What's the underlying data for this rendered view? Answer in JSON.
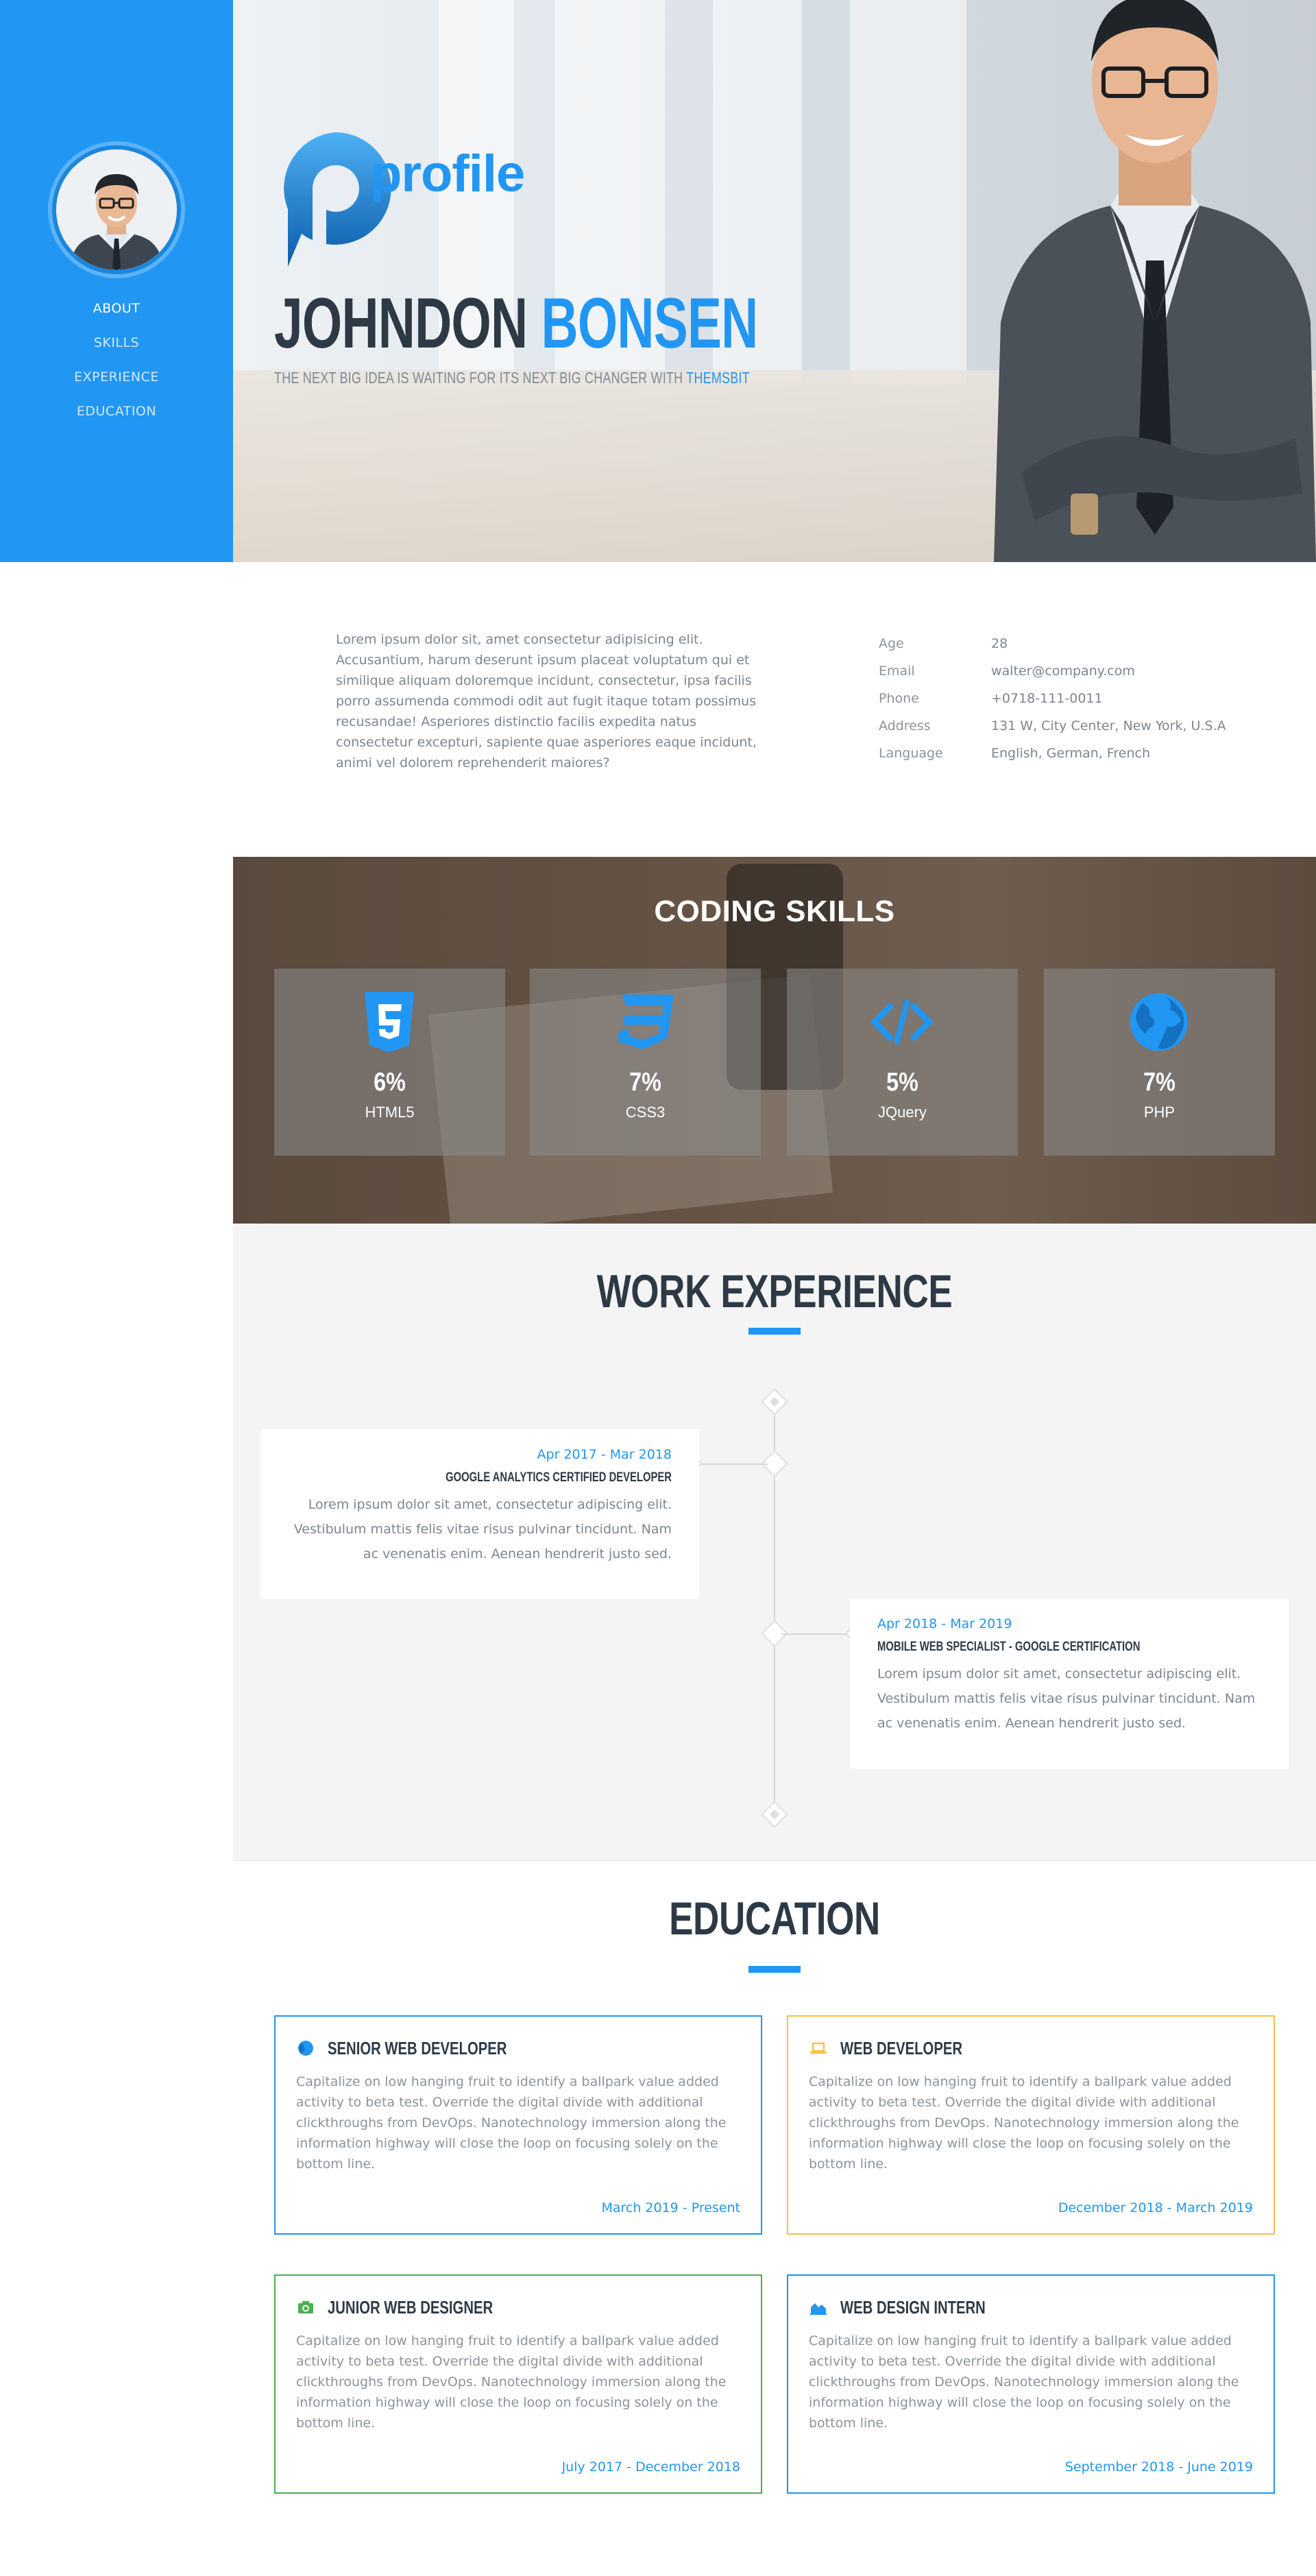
{
  "colors": {
    "accent": "#2196f3",
    "heading": "#2d3a46",
    "muted": "#7d8590",
    "green": "#4caf50",
    "yellow": "#f5c342"
  },
  "sidebar": {
    "nav": [
      {
        "label": "ABOUT",
        "active": true
      },
      {
        "label": "SKILLS",
        "active": false
      },
      {
        "label": "EXPERIENCE",
        "active": false
      },
      {
        "label": "EDUCATION",
        "active": false
      }
    ]
  },
  "hero": {
    "logo_text": "profile",
    "first_name": "JOHNDON",
    "last_name": "BONSEN",
    "tagline": "THE NEXT BIG IDEA IS WAITING FOR ITS NEXT BIG CHANGER WITH",
    "tagline_brand": "THEMSBIT"
  },
  "about": {
    "text": "Lorem ipsum dolor sit, amet consectetur adipisicing elit. Accusantium, harum deserunt ipsum placeat voluptatum qui et similique aliquam doloremque incidunt, consectetur, ipsa facilis porro assumenda commodi odit aut fugit itaque totam possimus recusandae! Asperiores distinctio facilis expedita natus consectetur excepturi, sapiente quae asperiores eaque incidunt, animi vel dolorem reprehenderit maiores?",
    "info": [
      {
        "key": "Age",
        "value": "28"
      },
      {
        "key": "Email",
        "value": "walter@company.com"
      },
      {
        "key": "Phone",
        "value": "+0718-111-0011"
      },
      {
        "key": "Address",
        "value": "131 W, City Center, New York, U.S.A"
      },
      {
        "key": "Language",
        "value": "English, German, French"
      }
    ]
  },
  "skills": {
    "title": "CODING SKILLS",
    "items": [
      {
        "icon": "html5-icon",
        "percent": "6%",
        "name": "HTML5"
      },
      {
        "icon": "css3-icon",
        "percent": "7%",
        "name": "CSS3"
      },
      {
        "icon": "code-icon",
        "percent": "5%",
        "name": "JQuery"
      },
      {
        "icon": "globe-icon",
        "percent": "7%",
        "name": "PHP"
      }
    ]
  },
  "experience": {
    "title": "WORK EXPERIENCE",
    "items": [
      {
        "date": "Apr 2017 - Mar 2018",
        "title": "GOOGLE ANALYTICS CERTIFIED DEVELOPER",
        "desc": "Lorem ipsum dolor sit amet, consectetur adipiscing elit. Vestibulum mattis felis vitae risus pulvinar tincidunt. Nam ac venenatis enim. Aenean hendrerit justo sed."
      },
      {
        "date": "Apr 2018 - Mar 2019",
        "title": "MOBILE WEB SPECIALIST - GOOGLE CERTIFICATION",
        "desc": "Lorem ipsum dolor sit amet, consectetur adipiscing elit. Vestibulum mattis felis vitae risus pulvinar tincidunt. Nam ac venenatis enim. Aenean hendrerit justo sed."
      }
    ]
  },
  "education": {
    "title": "EDUCATION",
    "items": [
      {
        "icon": "globe-icon",
        "color": "#2196f3",
        "title": "SENIOR WEB DEVELOPER",
        "desc": "Capitalize on low hanging fruit to identify a ballpark value added activity to beta test. Override the digital divide with additional clickthroughs from DevOps. Nanotechnology immersion along the information highway will close the loop on focusing solely on the bottom line.",
        "dates": "March 2019 - Present"
      },
      {
        "icon": "laptop-icon",
        "color": "#f5c342",
        "title": "WEB DEVELOPER",
        "desc": "Capitalize on low hanging fruit to identify a ballpark value added activity to beta test. Override the digital divide with additional clickthroughs from DevOps. Nanotechnology immersion along the information highway will close the loop on focusing solely on the bottom line.",
        "dates": "December 2018 - March 2019"
      },
      {
        "icon": "camera-icon",
        "color": "#4caf50",
        "title": "JUNIOR WEB DESIGNER",
        "desc": "Capitalize on low hanging fruit to identify a ballpark value added activity to beta test. Override the digital divide with additional clickthroughs from DevOps. Nanotechnology immersion along the information highway will close the loop on focusing solely on the bottom line.",
        "dates": "July 2017 - December 2018"
      },
      {
        "icon": "area-chart-icon",
        "color": "#2196f3",
        "title": "WEB DESIGN INTERN",
        "desc": "Capitalize on low hanging fruit to identify a ballpark value added activity to beta test. Override the digital divide with additional clickthroughs from DevOps. Nanotechnology immersion along the information highway will close the loop on focusing solely on the bottom line.",
        "dates": "September 2018 - June 2019"
      }
    ]
  }
}
